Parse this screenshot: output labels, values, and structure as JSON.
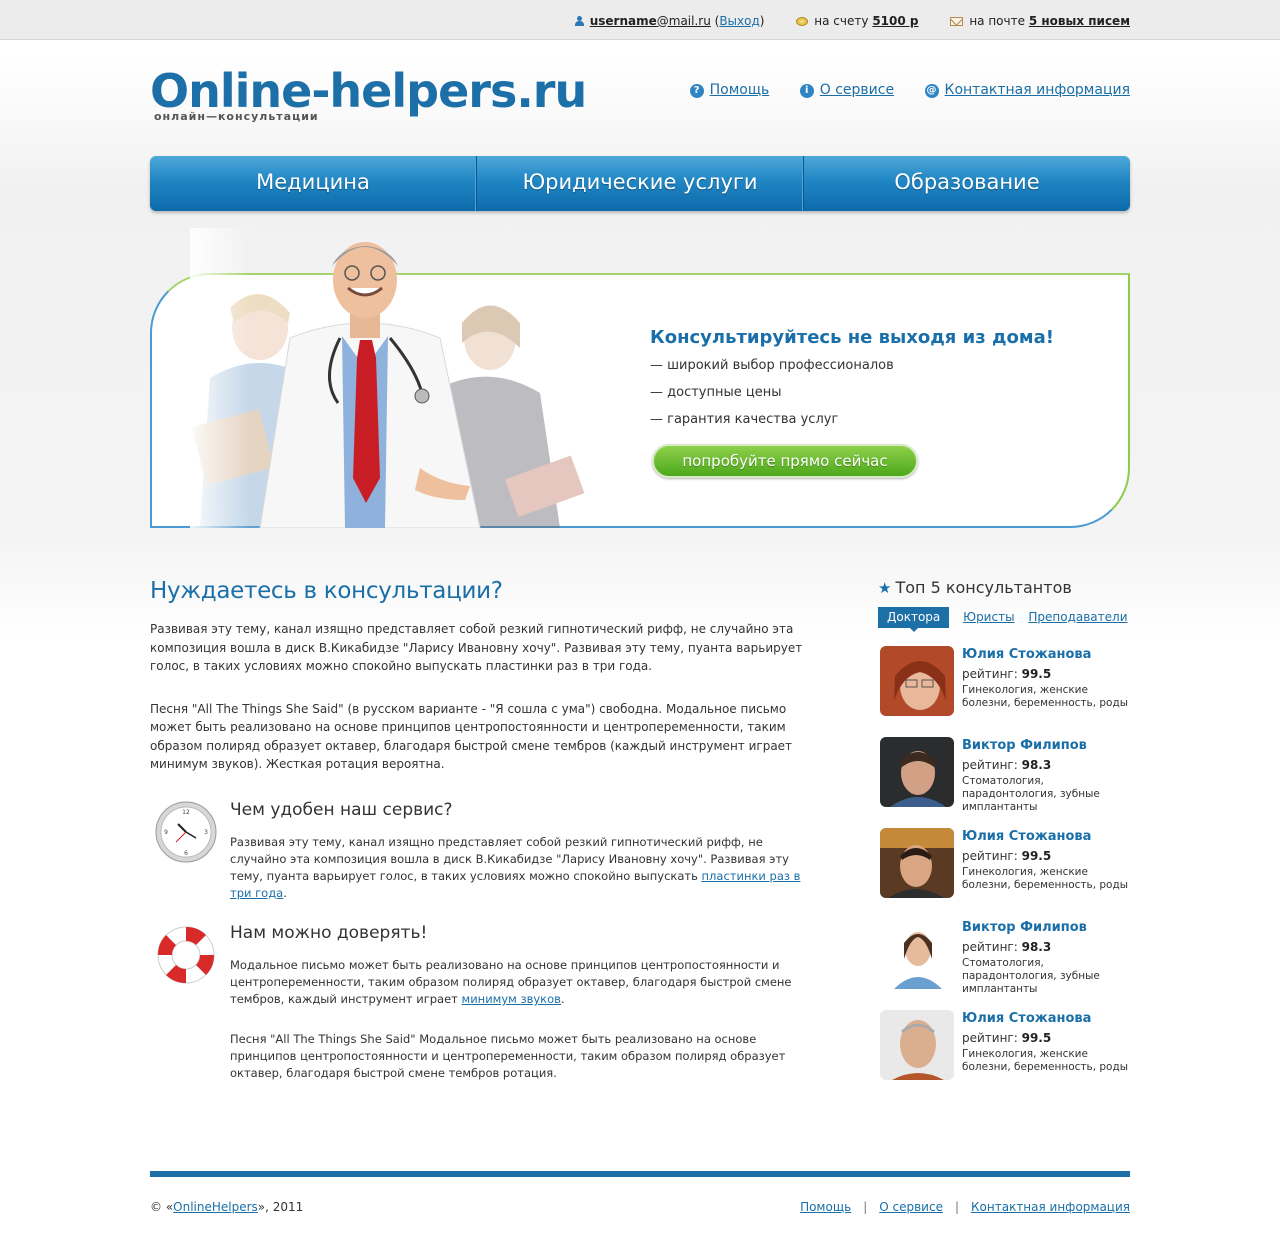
{
  "topbar": {
    "user_login": "username",
    "user_domain": "@mail.ru",
    "logout_label": "Выход",
    "balance_label": "на счету",
    "balance_value": "5100 р",
    "mail_label": "на почте",
    "mail_value": "5 новых писем"
  },
  "header": {
    "logo": "Online-helpers.ru",
    "tagline": "онлайн—консультации",
    "links": {
      "help": "Помощь",
      "about": "О сервисе",
      "contacts": "Контактная информация"
    }
  },
  "nav": {
    "items": [
      "Медицина",
      "Юридические услуги",
      "Образование"
    ]
  },
  "banner": {
    "title": "Консультируйтесь не выходя из дома!",
    "bullets": [
      "— широкий выбор профессионалов",
      "— доступные цены",
      "— гарантия качества услуг"
    ],
    "cta": "попробуйте прямо сейчас"
  },
  "main": {
    "title": "Нуждаетесь в консультации?",
    "paragraphs": [
      "Развивая эту тему, канал изящно представляет собой резкий гипнотический рифф, не случайно эта композиция вошла в диск В.Кикабидзе \"Ларису Ивановну хочу\". Развивая эту тему, пуанта варьирует голос, в таких условиях можно спокойно выпускать пластинки раз в три года.",
      "Песня \"All The Things She Said\" (в русском варианте - \"Я сошла с ума\") свободна. Модальное письмо может быть реализовано на основе принципов центропостоянности и центропеременности, таким образом полиряд образует октавер, благодаря быстрой смене тембров (каждый инструмент играет минимум звуков). Жесткая ротация вероятна."
    ],
    "feature1": {
      "title": "Чем удобен наш сервис?",
      "text": "Развивая эту тему, канал изящно представляет собой резкий гипнотический рифф, не случайно эта композиция вошла в диск В.Кикабидзе \"Ларису Ивановну хочу\". Развивая эту тему, пуанта варьирует голос, в таких условиях можно спокойно выпускать ",
      "link": "пластинки раз в три года",
      "tail": "."
    },
    "feature2": {
      "title": "Нам можно доверять!",
      "text": "Модальное письмо может быть реализовано на основе принципов центропостоянности и центропеременности, таким образом полиряд образует октавер, благодаря быстрой смене тембров, каждый инструмент играет ",
      "link": "минимум звуков",
      "tail": ".",
      "extra": "Песня \"All The Things She Said\" Модальное письмо может быть реализовано на основе принципов центропостоянности и центропеременности, таким образом полиряд образует октавер, благодаря быстрой смене тембров ротация."
    }
  },
  "sidebar": {
    "title": "Топ 5 консультантов",
    "tabs": [
      "Доктора",
      "Юристы",
      "Преподаватели"
    ],
    "rating_label": "рейтинг:",
    "consultants": [
      {
        "name": "Юлия Стожанова",
        "rating": "99.5",
        "spec": "Гинекология, женские болезни, беременность, роды"
      },
      {
        "name": "Виктор Филипов",
        "rating": "98.3",
        "spec": "Стоматология, парадонтология, зубные имплантанты"
      },
      {
        "name": "Юлия Стожанова",
        "rating": "99.5",
        "spec": "Гинекология, женские болезни, беременность, роды"
      },
      {
        "name": "Виктор Филипов",
        "rating": "98.3",
        "spec": "Стоматология, парадонтология, зубные имплантанты"
      },
      {
        "name": "Юлия Стожанова",
        "rating": "99.5",
        "spec": "Гинекология, женские болезни, беременность, роды"
      }
    ]
  },
  "footer": {
    "copyright_prefix": "© «",
    "copyright_link": "OnlineHelpers",
    "copyright_suffix": "», 2011",
    "links": {
      "help": "Помощь",
      "about": "О сервисе",
      "contacts": "Контактная информация"
    }
  },
  "colors": {
    "brand_blue": "#1d6fa8",
    "cta_green": "#5db52a",
    "banner_border_green": "#8ccc4c"
  }
}
